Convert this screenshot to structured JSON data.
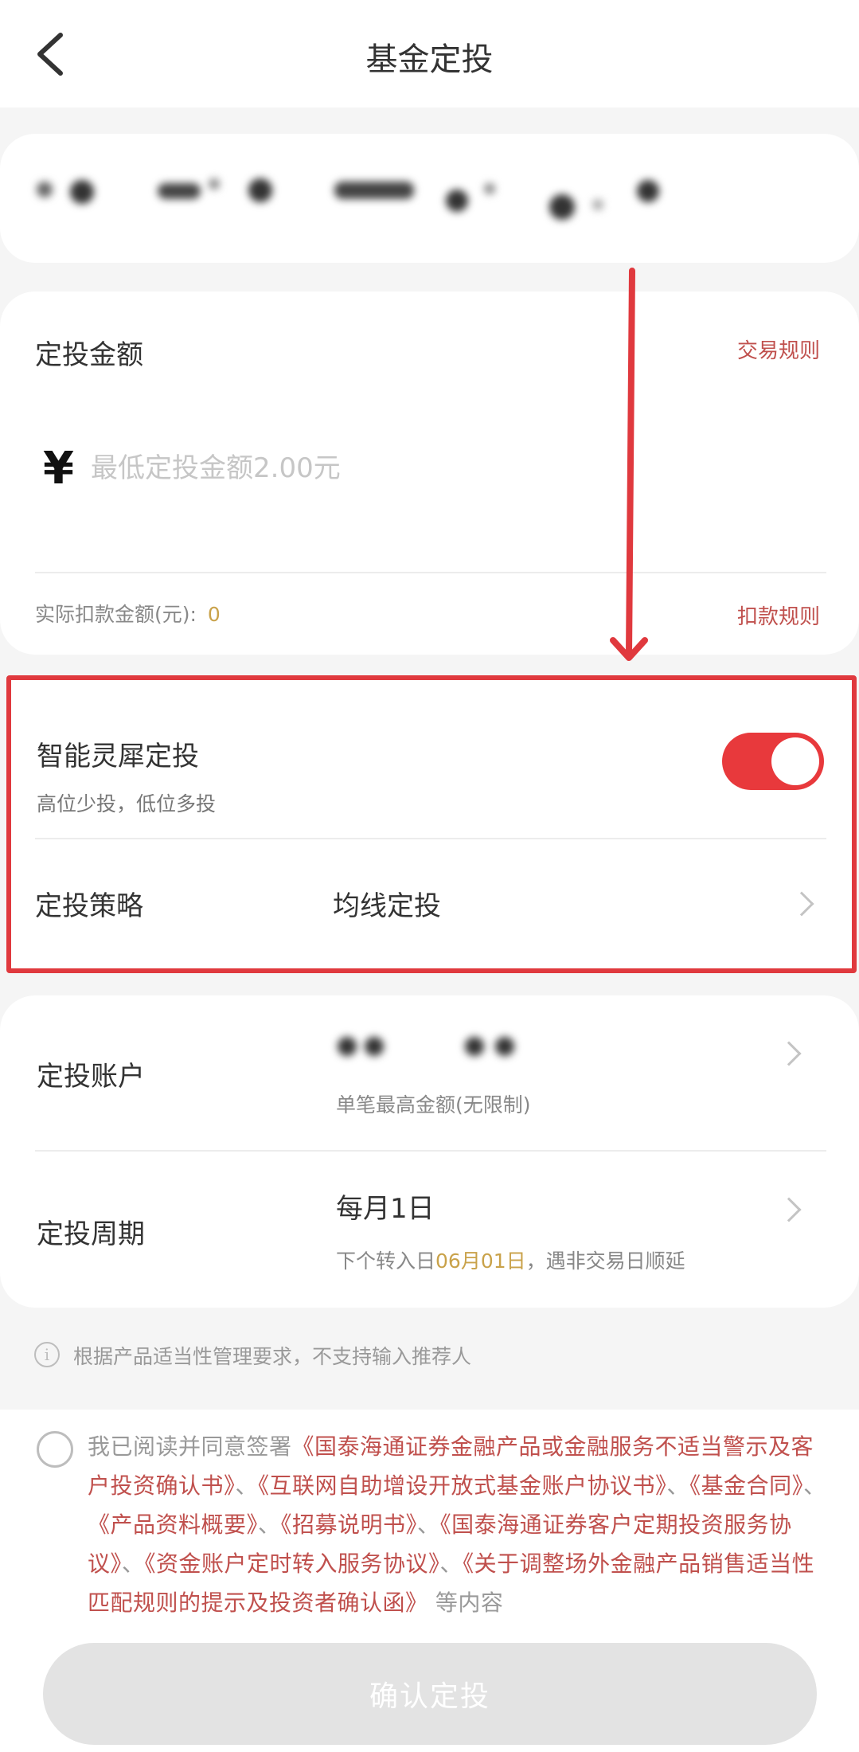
{
  "header": {
    "title": "基金定投",
    "back_icon": "chevron-left-icon"
  },
  "amount": {
    "label": "定投金额",
    "rules_link": "交易规则",
    "currency_symbol": "¥",
    "placeholder": "最低定投金额2.00元",
    "value": "",
    "actual_label": "实际扣款金额(元):",
    "actual_value": "0",
    "deduct_rules_link": "扣款规则"
  },
  "smart": {
    "title": "智能灵犀定投",
    "subtitle": "高位少投，低位多投",
    "enabled": true,
    "strategy_label": "定投策略",
    "strategy_value": "均线定投"
  },
  "account": {
    "label": "定投账户",
    "limit_text": "单笔最高金额(无限制)"
  },
  "cycle": {
    "label": "定投周期",
    "value": "每月1日",
    "next_prefix": "下个转入日",
    "next_date": "06月01日",
    "next_suffix": "，遇非交易日顺延"
  },
  "notice": "根据产品适当性管理要求，不支持输入推荐人",
  "agreement": {
    "prefix": "我已阅读并同意签署",
    "docs": [
      "《国泰海通证券金融产品或金融服务不适当警示及客户投资确认书》",
      "《互联网自助增设开放式基金账户协议书》",
      "《基金合同》",
      "《产品资料概要》",
      "《招募说明书》",
      "《国泰海通证券客户定期投资服务协议》",
      "《资金账户定时转入服务协议》",
      "《关于调整场外金融产品销售适当性匹配规则的提示及投资者确认函》"
    ],
    "separator": "、",
    "suffix": "等内容"
  },
  "confirm_button": "确认定投",
  "colors": {
    "accent_red": "#e8393c",
    "link_red": "#c0504d",
    "gold": "#c9a24a"
  }
}
